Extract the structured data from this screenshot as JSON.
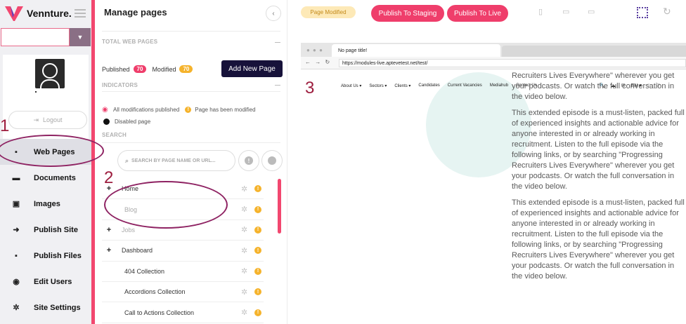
{
  "brand": {
    "name": "Vennture."
  },
  "sidebar": {
    "logout_label": "Logout",
    "items": [
      {
        "label": "Web Pages",
        "icon": "file-icon",
        "glyph": "▪",
        "active": true
      },
      {
        "label": "Documents",
        "icon": "folder-icon",
        "glyph": "▬"
      },
      {
        "label": "Images",
        "icon": "image-icon",
        "glyph": "▣"
      },
      {
        "label": "Publish Site",
        "icon": "publish-icon",
        "glyph": "➜"
      },
      {
        "label": "Publish Files",
        "icon": "publish-file-icon",
        "glyph": "▪"
      },
      {
        "label": "Edit Users",
        "icon": "user-icon",
        "glyph": "◉"
      },
      {
        "label": "Site Settings",
        "icon": "gear-icon",
        "glyph": "✲"
      }
    ]
  },
  "panel": {
    "title": "Manage pages",
    "total_label": "TOTAL WEB PAGES",
    "published_label": "Published",
    "published_count": "70",
    "modified_label": "Modified",
    "modified_count": "70",
    "add_page_label": "Add New Page",
    "indicators_label": "INDICATORS",
    "indicator_all_published": "All modifications published",
    "indicator_modified": "Page has been modified",
    "indicator_disabled": "Disabled page",
    "search_label": "SEARCH",
    "search_placeholder": "SEARCH BY PAGE NAME OR URL...",
    "pages": [
      {
        "name": "Home",
        "expandable": true,
        "disabled": false
      },
      {
        "name": "Blog",
        "expandable": false,
        "disabled": true
      },
      {
        "name": "Jobs",
        "expandable": true,
        "disabled": true
      },
      {
        "name": "Dashboard",
        "expandable": true,
        "disabled": false
      },
      {
        "name": "404 Collection",
        "expandable": false,
        "disabled": false
      },
      {
        "name": "Accordions Collection",
        "expandable": false,
        "disabled": false
      },
      {
        "name": "Call to Actions Collection",
        "expandable": false,
        "disabled": false
      }
    ]
  },
  "toolbar": {
    "status": "Page Modified",
    "publish_staging": "Publish To Staging",
    "publish_live": "Publish To Live"
  },
  "preview": {
    "tab_title": "No page title!",
    "url": "https://modules-live.aptevetest.net/test/",
    "nav_items": [
      "About Us ▾",
      "Sectors ▾",
      "Clients ▾",
      "Candidates",
      "Current Vacancies",
      "Mediahub",
      "Contact Us"
    ],
    "nav_icons": [
      "🔍",
      "☁",
      "✉",
      "EN ▾",
      "◌",
      "♡"
    ],
    "partial_text": "Recruiters Lives Everywhere\" wherever you get your podcasts. Or watch the full conversation in the video below.",
    "paragraph": "This extended episode is a must-listen, packed full of experienced insights and actionable advice for anyone interested in or already working in recruitment. Listen to the full episode via the following links, or by searching \"Progressing Recruiters Lives Everywhere\" wherever you get your podcasts. Or watch the full conversation in the video below."
  },
  "annotations": {
    "step1": "1",
    "step2": "2",
    "step3": "3"
  },
  "colors": {
    "accent": "#ef3e6b",
    "navy": "#17123a",
    "annotation": "#8e2262",
    "warning": "#f5b32c"
  }
}
